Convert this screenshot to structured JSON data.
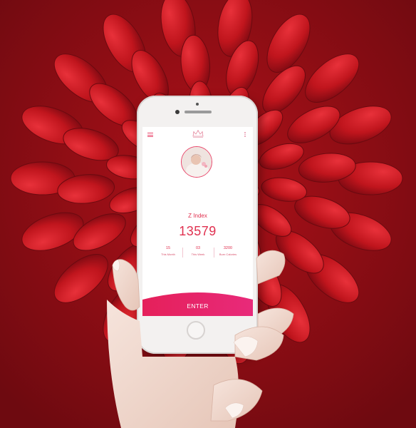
{
  "screen": {
    "index_label": "Z Index",
    "index_value": "13579",
    "stats": [
      {
        "value": "15",
        "label": "This Month"
      },
      {
        "value": "03",
        "label": "This Week"
      },
      {
        "value": "3200",
        "label": "Burn Calories"
      }
    ],
    "enter_label": "ENTER"
  },
  "icons": {
    "menu": "hamburger-menu-icon",
    "logo": "crown-logo",
    "more": "vertical-dots-icon",
    "avatar": "profile-photo"
  },
  "colors": {
    "accent": "#e0304f",
    "button_gradient_start": "#e5205a",
    "button_gradient_end": "#e82a7a",
    "background": "#8a0d14",
    "petal": "#c0151d"
  }
}
